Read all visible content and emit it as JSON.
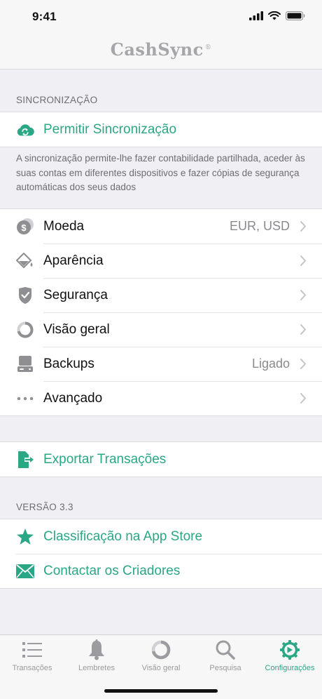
{
  "status": {
    "time": "9:41"
  },
  "header": {
    "title": "CashSync",
    "trademark": "®"
  },
  "sync_section": {
    "header": "SINCRONIZAÇÃO",
    "enable_label": "Permitir Sincronização",
    "description": "A sincronização permite-lhe fazer contabilidade partilhada, aceder às suas contas em diferentes dispositivos e fazer cópias de segurança automáticas dos seus dados"
  },
  "settings": {
    "items": [
      {
        "label": "Moeda",
        "value": "EUR, USD",
        "icon": "currency-icon"
      },
      {
        "label": "Aparência",
        "value": "",
        "icon": "paint-bucket-icon"
      },
      {
        "label": "Segurança",
        "value": "",
        "icon": "shield-icon"
      },
      {
        "label": "Visão geral",
        "value": "",
        "icon": "overview-ring-icon"
      },
      {
        "label": "Backups",
        "value": "Ligado",
        "icon": "backup-drive-icon"
      },
      {
        "label": "Avançado",
        "value": "",
        "icon": "more-dots-icon"
      }
    ]
  },
  "export": {
    "label": "Exportar Transações"
  },
  "version_section": {
    "header": "VERSÃO 3.3",
    "rate_label": "Classificação na App Store",
    "contact_label": "Contactar os Criadores"
  },
  "tabs": [
    {
      "label": "Transações",
      "icon": "list-icon",
      "active": false
    },
    {
      "label": "Lembretes",
      "icon": "bell-icon",
      "active": false
    },
    {
      "label": "Visão geral",
      "icon": "overview-ring-icon",
      "active": false
    },
    {
      "label": "Pesquisa",
      "icon": "search-icon",
      "active": false
    },
    {
      "label": "Configurações",
      "icon": "gear-icon",
      "active": true
    }
  ],
  "colors": {
    "accent": "#2aa785",
    "icon_gray": "#8e8e93",
    "background": "#efeff4"
  }
}
